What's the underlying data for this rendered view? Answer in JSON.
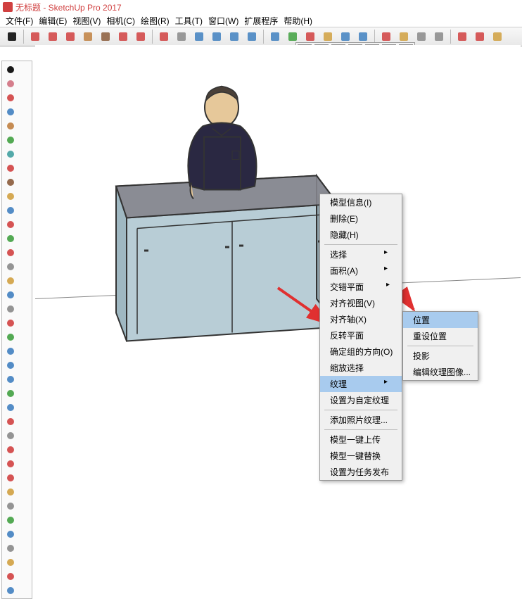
{
  "title": "无标题 - SketchUp Pro 2017",
  "menus": [
    "文件(F)",
    "编辑(E)",
    "视图(V)",
    "相机(C)",
    "绘图(R)",
    "工具(T)",
    "窗口(W)",
    "扩展程序",
    "帮助(H)"
  ],
  "toolbar_icons": [
    "select",
    "paint",
    "pencil",
    "arc",
    "shape",
    "push",
    "move",
    "rotate",
    "scale",
    "tape",
    "text",
    "orbit",
    "pan",
    "zoom",
    "zoom-ext",
    "add",
    "cut",
    "paste",
    "undo",
    "redo",
    "warehouse",
    "layout",
    "print",
    "settings",
    "cloud",
    "record",
    "help"
  ],
  "secondary_icons": [
    "house",
    "doc",
    "home",
    "window",
    "window2",
    "scene",
    "layers"
  ],
  "left_tools": [
    "select",
    "eraser",
    "pencil",
    "line",
    "rect",
    "circle",
    "arc",
    "arc2",
    "push",
    "follow",
    "offset",
    "move",
    "rotate",
    "scale",
    "tape",
    "protractor",
    "text",
    "dim",
    "axes",
    "section",
    "orbit",
    "pan",
    "zoom",
    "walk",
    "look",
    "paint",
    "sample",
    "3d",
    "warehouse",
    "share",
    "ext",
    "sandbox",
    "solid",
    "outliner",
    "find",
    "scale2",
    "person",
    "layers2"
  ],
  "context_menu_1": {
    "items": [
      {
        "label": "模型信息(I)",
        "sub": false
      },
      {
        "label": "删除(E)",
        "sub": false
      },
      {
        "label": "隐藏(H)",
        "sub": false
      },
      {
        "sep": true
      },
      {
        "label": "选择",
        "sub": true
      },
      {
        "label": "面积(A)",
        "sub": true
      },
      {
        "label": "交错平面",
        "sub": true
      },
      {
        "label": "对齐视图(V)",
        "sub": false
      },
      {
        "label": "对齐轴(X)",
        "sub": false
      },
      {
        "label": "反转平面",
        "sub": false
      },
      {
        "label": "确定组的方向(O)",
        "sub": true
      },
      {
        "label": "缩放选择",
        "sub": false
      },
      {
        "label": "纹理",
        "sub": true,
        "hl": true
      },
      {
        "label": "设置为自定纹理",
        "sub": false
      },
      {
        "sep": true
      },
      {
        "label": "添加照片纹理...",
        "sub": false
      },
      {
        "sep": true
      },
      {
        "label": "模型一键上传",
        "sub": false
      },
      {
        "label": "模型一键替换",
        "sub": false
      },
      {
        "label": "设置为任务发布",
        "sub": false
      }
    ]
  },
  "context_menu_2": {
    "items": [
      {
        "label": "位置",
        "hl": true
      },
      {
        "label": "重设位置"
      },
      {
        "sep": true
      },
      {
        "label": "投影"
      },
      {
        "label": "编辑纹理图像..."
      }
    ]
  }
}
